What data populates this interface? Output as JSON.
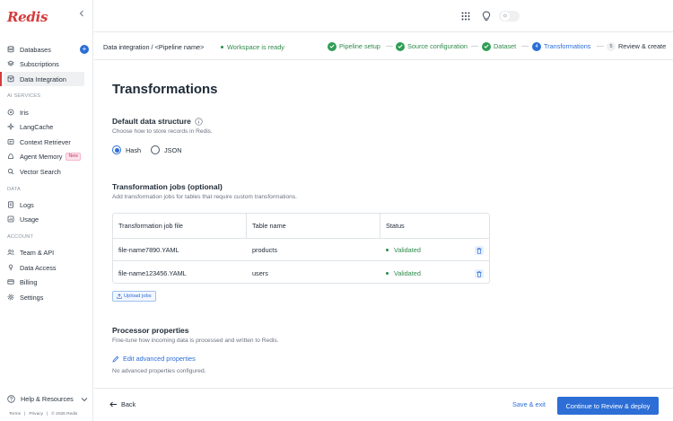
{
  "app": {
    "logo": "Redis",
    "collapse_icon": "chevron-left-icon"
  },
  "sidebar": {
    "top_items": [
      {
        "label": "Databases",
        "icon": "database-icon",
        "badge": "+"
      },
      {
        "label": "Subscriptions",
        "icon": "layers-icon"
      },
      {
        "label": "Data Integration",
        "icon": "data-integration-icon",
        "active": true
      }
    ],
    "ai_section": "AI SERVICES",
    "ai_items": [
      {
        "label": "Iris",
        "icon": "iris-icon"
      },
      {
        "label": "LangCache",
        "icon": "sparkle-icon"
      },
      {
        "label": "Context Retriever",
        "icon": "retriever-icon"
      },
      {
        "label": "Agent Memory",
        "icon": "memory-icon",
        "badge": "New"
      },
      {
        "label": "Vector Search",
        "icon": "vector-search-icon"
      }
    ],
    "data_section": "DATA",
    "data_items": [
      {
        "label": "Logs",
        "icon": "logs-icon"
      },
      {
        "label": "Usage",
        "icon": "usage-icon"
      }
    ],
    "account_section": "ACCOUNT",
    "account_items": [
      {
        "label": "Team & API",
        "icon": "team-icon"
      },
      {
        "label": "Data Access",
        "icon": "key-icon"
      },
      {
        "label": "Billing",
        "icon": "billing-icon"
      },
      {
        "label": "Settings",
        "icon": "gear-icon"
      }
    ],
    "help": "Help & Resources",
    "footer": {
      "terms": "Terms",
      "sep": "|",
      "privacy": "Privacy",
      "copyright": "© 2026 Redis"
    }
  },
  "topbar": {
    "icons": [
      "apps-grid-icon",
      "lightbulb-icon",
      "theme-toggle-icon"
    ]
  },
  "header": {
    "breadcrumb": "Data integration / <Pipeline name>",
    "status": "Workspace is ready",
    "steps": [
      {
        "label": "Pipeline setup",
        "state": "done"
      },
      {
        "label": "Source configuration",
        "state": "done"
      },
      {
        "label": "Dataset",
        "state": "done"
      },
      {
        "label": "Transformations",
        "state": "current",
        "number": "4"
      },
      {
        "label": "Review & create",
        "state": "todo",
        "number": "5"
      }
    ]
  },
  "main": {
    "title": "Transformations",
    "data_structure": {
      "heading": "Default data structure",
      "description": "Choose how to store records in Redis.",
      "options": [
        {
          "label": "Hash",
          "selected": true
        },
        {
          "label": "JSON",
          "selected": false
        }
      ]
    },
    "jobs": {
      "heading": "Transformation jobs (optional)",
      "description": "Add transformation jobs for tables that require custom transformations.",
      "columns": [
        "Transformation job file",
        "Table name",
        "Status"
      ],
      "rows": [
        {
          "file": "file-name7890.YAML",
          "table": "products",
          "status": "Validated"
        },
        {
          "file": "file-name123456.YAML",
          "table": "users",
          "status": "Validated"
        }
      ],
      "upload_label": "Upload jobs"
    },
    "processor": {
      "heading": "Processor properties",
      "description": "Fine-tune how incoming data is processed and written to Redis.",
      "edit_label": "Edit advanced properties",
      "note": "No advanced properties configured."
    }
  },
  "footer_bar": {
    "back": "Back",
    "save": "Save & exit",
    "continue": "Continue to Review & deploy"
  },
  "colors": {
    "accent": "#2c6ed6",
    "success": "#2f8a4b",
    "brand": "#d63a3a"
  }
}
